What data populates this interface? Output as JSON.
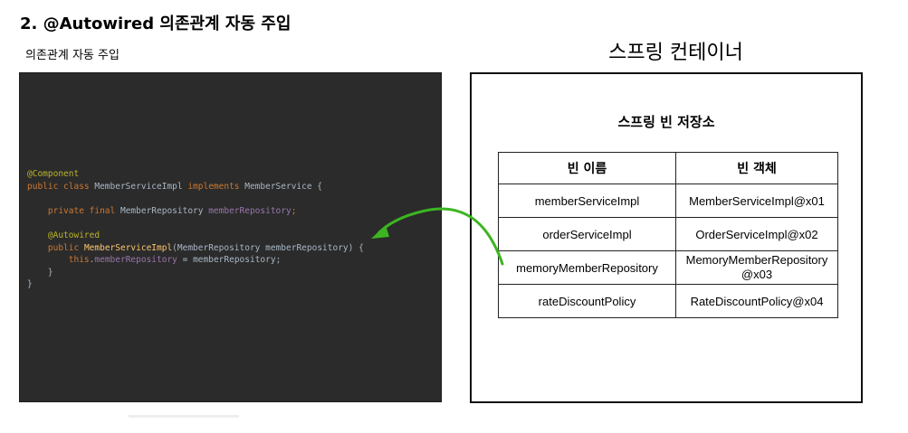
{
  "slide": {
    "title": "2. @Autowired 의존관계 자동 주입",
    "code_caption": "의존관계 자동 주입",
    "container_caption": "스프링 컨테이너"
  },
  "code": {
    "line1": "@Component",
    "line2_kw": "public class ",
    "line2_name": "MemberServiceImpl ",
    "line2_kw2": "implements ",
    "line2_rest": "MemberService {",
    "line3_kw": "private final ",
    "line3_type": "MemberRepository ",
    "line3_field": "memberRepository",
    "line3_end": ";",
    "line4": "@Autowired",
    "line5_kw": "public ",
    "line5_fn": "MemberServiceImpl",
    "line5_rest": "(MemberRepository memberRepository) {",
    "line6_kw": "this",
    "line6_dot": ".",
    "line6_field": "memberRepository",
    "line6_rest": " = memberRepository;",
    "line7": "}",
    "line8": "}"
  },
  "store": {
    "title": "스프링 빈 저장소",
    "headers": [
      "빈 이름",
      "빈 객체"
    ],
    "rows": [
      [
        "memberServiceImpl",
        "MemberServiceImpl@x01"
      ],
      [
        "orderServiceImpl",
        "OrderServiceImpl@x02"
      ],
      [
        "memoryMemberRepository",
        "MemoryMemberRepository\n@x03"
      ],
      [
        "rateDiscountPolicy",
        "RateDiscountPolicy@x04"
      ]
    ]
  },
  "colors": {
    "code_background": "#2b2b2b",
    "annotation": "#bbb529",
    "keyword": "#cc7832",
    "field": "#9876aa",
    "method": "#ffc66d",
    "arrow": "#3cb521"
  }
}
